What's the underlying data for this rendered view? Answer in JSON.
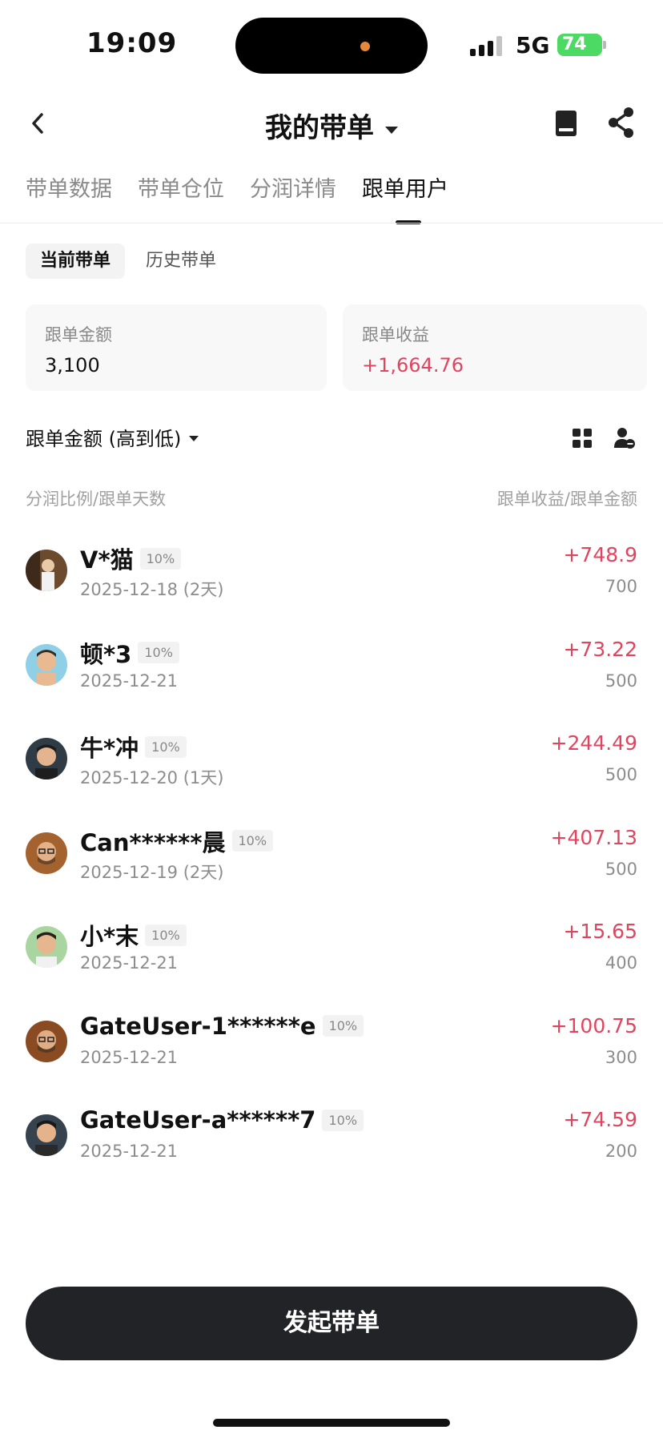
{
  "status": {
    "time": "19:09",
    "network": "5G",
    "battery": "74"
  },
  "nav": {
    "title": "我的带单"
  },
  "tabs": [
    {
      "label": "带单数据"
    },
    {
      "label": "带单仓位"
    },
    {
      "label": "分润详情"
    },
    {
      "label": "跟单用户",
      "active": true
    }
  ],
  "subtabs": [
    {
      "label": "当前带单",
      "active": true
    },
    {
      "label": "历史带单"
    }
  ],
  "summary": {
    "amount_label": "跟单金额",
    "amount_value": "3,100",
    "profit_label": "跟单收益",
    "profit_value": "+1,664.76"
  },
  "sort": {
    "label": "跟单金额 (高到低)"
  },
  "list_header": {
    "left": "分润比例/跟单天数",
    "right": "跟单收益/跟单金额"
  },
  "users": [
    {
      "name": "V*猫",
      "ratio": "10%",
      "date": "2025-12-18 (2天)",
      "profit": "+748.9",
      "amount": "700"
    },
    {
      "name": "顿*3",
      "ratio": "10%",
      "date": "2025-12-21",
      "profit": "+73.22",
      "amount": "500"
    },
    {
      "name": "牛*冲",
      "ratio": "10%",
      "date": "2025-12-20 (1天)",
      "profit": "+244.49",
      "amount": "500"
    },
    {
      "name": "Can******晨",
      "ratio": "10%",
      "date": "2025-12-19 (2天)",
      "profit": "+407.13",
      "amount": "500"
    },
    {
      "name": "小*末",
      "ratio": "10%",
      "date": "2025-12-21",
      "profit": "+15.65",
      "amount": "400"
    },
    {
      "name": "GateUser-1******e",
      "ratio": "10%",
      "date": "2025-12-21",
      "profit": "+100.75",
      "amount": "300"
    },
    {
      "name": "GateUser-a******7",
      "ratio": "10%",
      "date": "2025-12-21",
      "profit": "+74.59",
      "amount": "200"
    }
  ],
  "cta": {
    "label": "发起带单"
  },
  "colors": {
    "positive": "#e0455f",
    "cta_bg": "#222326",
    "battery": "#4cd964"
  }
}
